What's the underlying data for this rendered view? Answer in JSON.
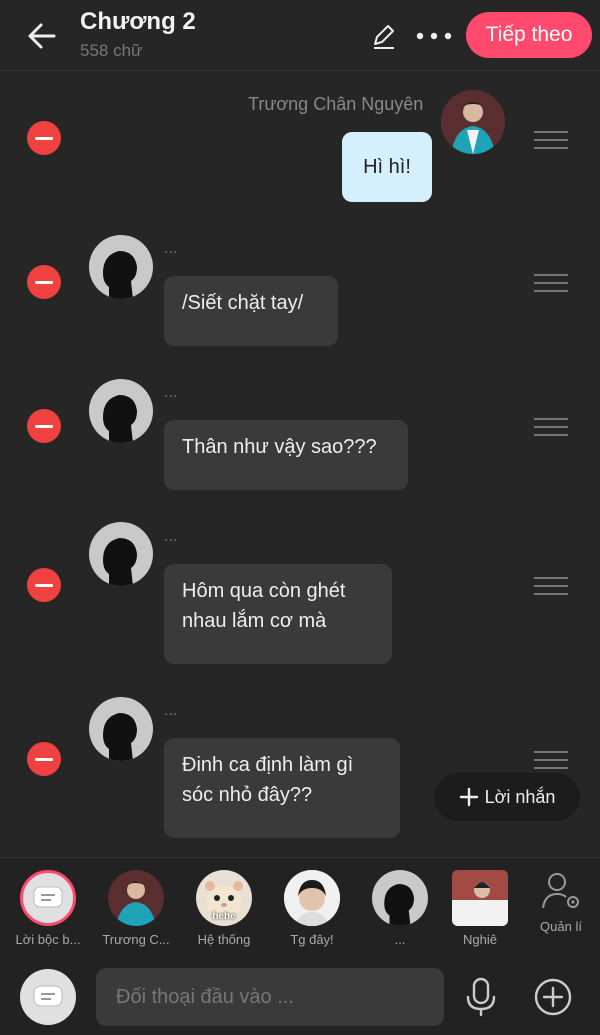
{
  "header": {
    "title": "Chương 2",
    "word_count": "558 chữ",
    "next_label": "Tiếp theo"
  },
  "messages": [
    {
      "side": "right",
      "name": "Trương Chân Nguyên",
      "text": "Hì hì!"
    },
    {
      "side": "left",
      "name": "...",
      "text": "/Siết chặt tay/"
    },
    {
      "side": "left",
      "name": "...",
      "text": "Thân như vậy sao???"
    },
    {
      "side": "left",
      "name": "...",
      "text": "Hôm qua còn ghét nhau lắm cơ mà"
    },
    {
      "side": "left",
      "name": "...",
      "text": "Đinh ca định làm gì sóc nhỏ đây??"
    }
  ],
  "add_note_label": "Lời nhắn",
  "characters": [
    {
      "label": "Lời bộc b...",
      "avatar": "narration-icon"
    },
    {
      "label": "Trương C...",
      "avatar": "teal-jacket-photo"
    },
    {
      "label": "Hệ thống",
      "avatar": "hamster-photo",
      "sticker_text": "hehe"
    },
    {
      "label": "Tg đây!",
      "avatar": "boy-photo"
    },
    {
      "label": "...",
      "avatar": "silhouette"
    },
    {
      "label": "Nghiê",
      "avatar": "white-shirt-photo"
    },
    {
      "label": "Quản lí",
      "avatar": "user-gear-icon"
    }
  ],
  "input": {
    "placeholder": "Đối thoại đầu vào ..."
  },
  "colors": {
    "accent": "#ff4a6e",
    "remove": "#f04141",
    "bubble_right": "#d4f0ff",
    "bubble_left": "#3a3a3a",
    "background": "#262626"
  }
}
